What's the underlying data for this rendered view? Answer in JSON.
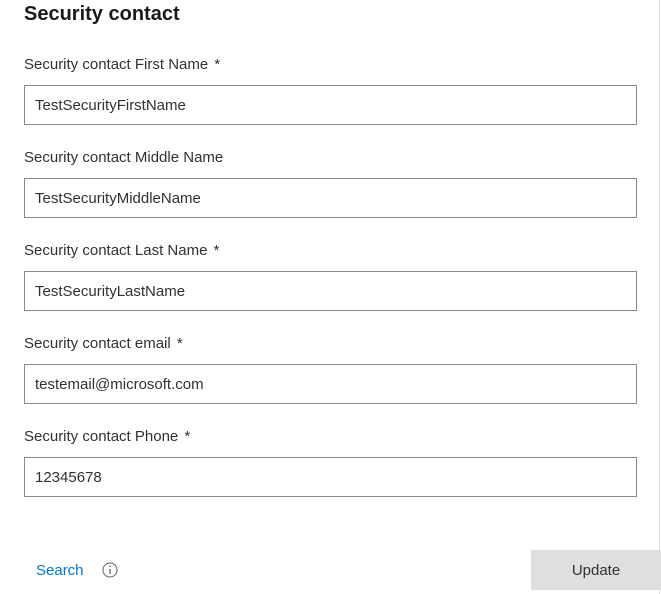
{
  "section": {
    "title": "Security contact"
  },
  "fields": {
    "firstName": {
      "label": "Security contact First Name",
      "required": "*",
      "value": "TestSecurityFirstName"
    },
    "middleName": {
      "label": "Security contact Middle Name",
      "required": "",
      "value": "TestSecurityMiddleName"
    },
    "lastName": {
      "label": "Security contact Last Name",
      "required": "*",
      "value": "TestSecurityLastName"
    },
    "email": {
      "label": "Security contact email",
      "required": "*",
      "value": "testemail@microsoft.com"
    },
    "phone": {
      "label": "Security contact Phone",
      "required": "*",
      "value": "12345678"
    }
  },
  "footer": {
    "search_label": "Search",
    "update_label": "Update"
  }
}
